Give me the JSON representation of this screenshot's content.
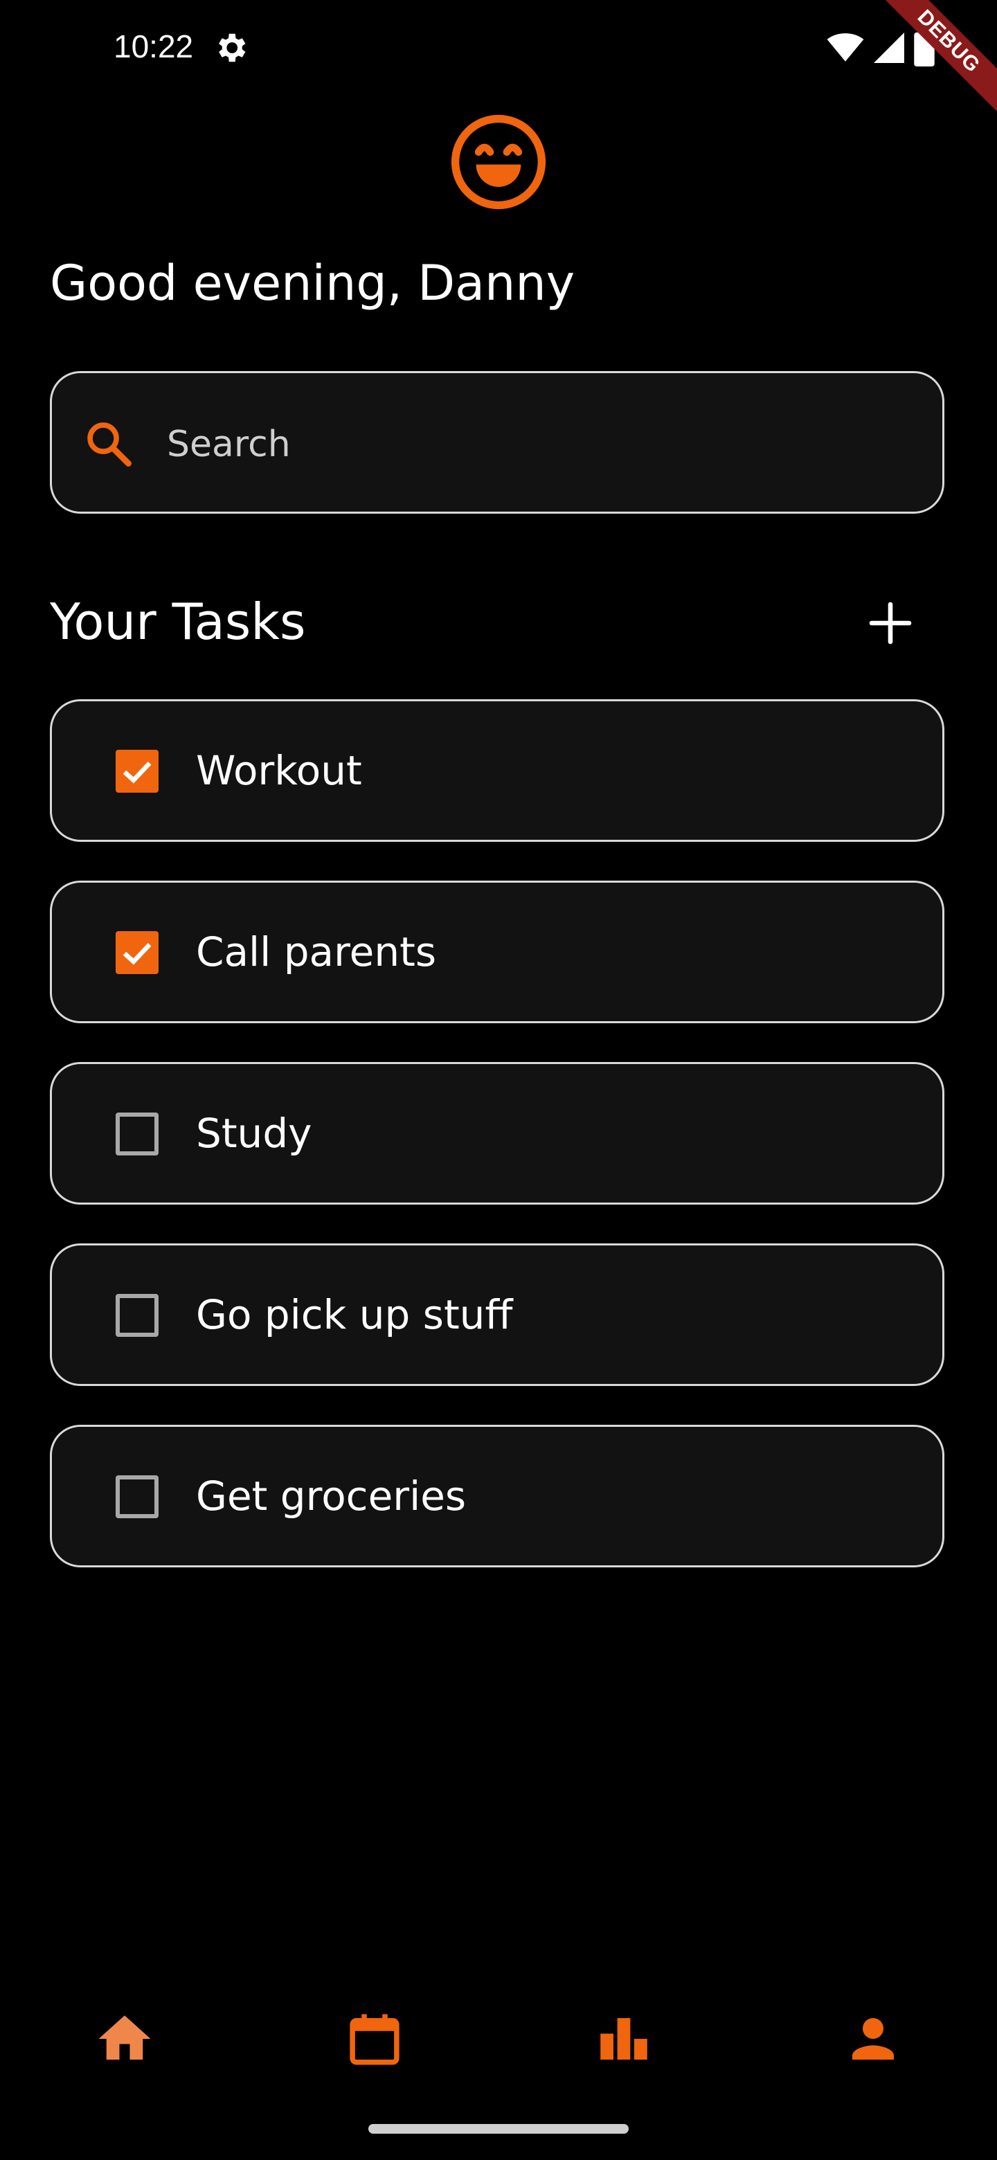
{
  "status_bar": {
    "time": "10:22",
    "icons": [
      "gear-icon",
      "wifi-icon",
      "signal-icon",
      "battery-icon"
    ],
    "debug_banner": "DEBUG"
  },
  "header": {
    "logo_icon": "laughing-face-icon",
    "greeting": "Good evening, Danny"
  },
  "search": {
    "placeholder": "Search",
    "value": ""
  },
  "tasks": {
    "title": "Your Tasks",
    "add_icon": "plus-icon",
    "items": [
      {
        "label": "Workout",
        "checked": true
      },
      {
        "label": "Call parents",
        "checked": true
      },
      {
        "label": "Study",
        "checked": false
      },
      {
        "label": "Go pick up stuff",
        "checked": false
      },
      {
        "label": "Get groceries",
        "checked": false
      }
    ]
  },
  "bottom_nav": {
    "items": [
      {
        "icon": "home-icon",
        "active": true
      },
      {
        "icon": "calendar-icon",
        "active": false
      },
      {
        "icon": "bar-chart-icon",
        "active": false
      },
      {
        "icon": "person-icon",
        "active": false
      }
    ]
  },
  "colors": {
    "background": "#000000",
    "card": "#121212",
    "accent": "#f0650e",
    "accent_active": "#f0874a",
    "border": "#d9d9d9",
    "debug": "#8b1a1a"
  }
}
